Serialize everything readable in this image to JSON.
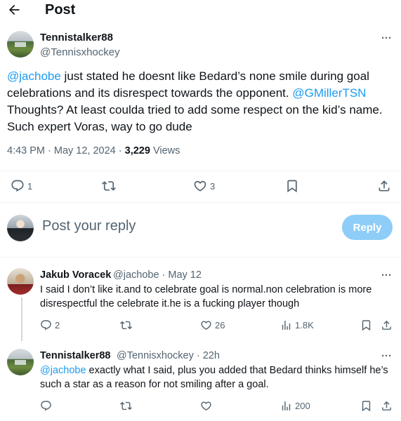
{
  "header": {
    "title": "Post",
    "back_icon": "arrow-left-icon"
  },
  "main_post": {
    "author_name": "Tennistalker88",
    "author_handle": "@Tennisxhockey",
    "text_parts": {
      "mention1": "@jachobe",
      "text1": " just stated he doesnt like Bedard’s none smile during goal celebrations and its disrespect towards the opponent. ",
      "mention2": "@GMillerTSN",
      "text2": " Thoughts? At least coulda tried to add some respect on the kid’s name. Such expert Voras, way to go dude"
    },
    "timestamp": "4:43 PM · May 12, 2024 · ",
    "views_count": "3,229",
    "views_label": " Views",
    "actions": {
      "replies": "1",
      "reposts": "",
      "likes": "3"
    }
  },
  "composer": {
    "placeholder": "Post your reply",
    "reply_button": "Reply"
  },
  "replies": [
    {
      "author_name": "Jakub Voracek",
      "author_handle": "@jachobe · May 12",
      "text": "I said I don’t like it.and to celebrate goal is normal.non celebration is more disrespectful the celebrate it.he is a fucking player though",
      "replies": "2",
      "reposts": "",
      "likes": "26",
      "views": "1.8K"
    },
    {
      "author_name": "Tennistalker88",
      "author_handle": "@Tennisxhockey · 22h",
      "mention": "@jachobe",
      "text": " exactly what I said, plus you added that Bedard thinks himself he’s such a star as a reason for not smiling after a goal.",
      "replies": "",
      "reposts": "",
      "likes": "",
      "views": "200"
    }
  ],
  "more_label": "···",
  "colors": {
    "accent": "#1d9bf0",
    "secondary_text": "#536471",
    "reply_button_disabled": "#8ecdf8"
  }
}
